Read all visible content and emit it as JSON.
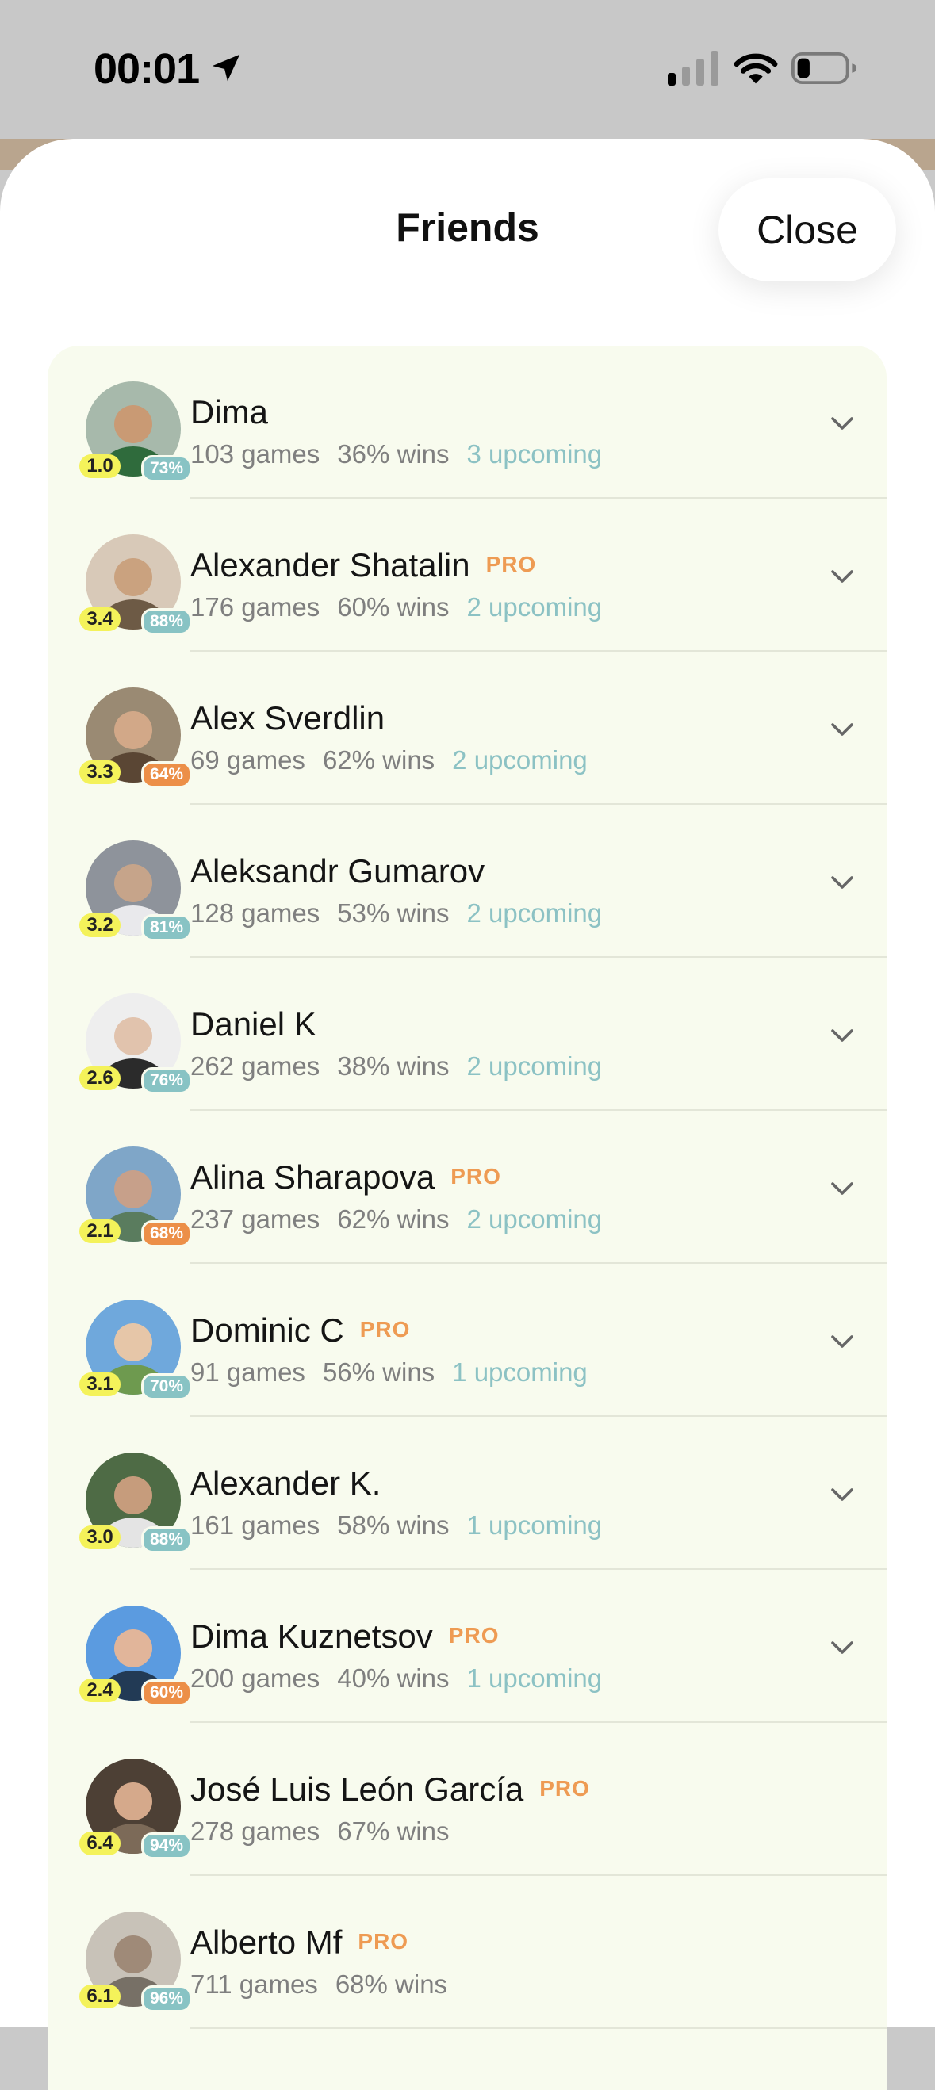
{
  "status_bar": {
    "time": "00:01",
    "icons": [
      "location-arrow-icon",
      "cellular-signal-icon",
      "wifi-icon",
      "battery-icon"
    ]
  },
  "sheet": {
    "title": "Friends",
    "close_label": "Close"
  },
  "colors": {
    "card_bg": "#f8fbee",
    "rating_badge": "#f4f25a",
    "pct_teal": "#88c3c4",
    "pct_orange": "#ec8f48",
    "pro": "#ee9b53",
    "upcoming": "#8cc2c4"
  },
  "friends": [
    {
      "name": "Dima",
      "pro": "",
      "rating": "1.0",
      "pct": "73%",
      "pct_color": "teal",
      "games": "103 games",
      "wins": "36% wins",
      "upcoming": "3 upcoming",
      "expandable": true
    },
    {
      "name": "Alexander Shatalin",
      "pro": "PRO",
      "rating": "3.4",
      "pct": "88%",
      "pct_color": "teal",
      "games": "176 games",
      "wins": "60% wins",
      "upcoming": "2 upcoming",
      "expandable": true
    },
    {
      "name": "Alex Sverdlin",
      "pro": "",
      "rating": "3.3",
      "pct": "64%",
      "pct_color": "orange",
      "games": "69 games",
      "wins": "62% wins",
      "upcoming": "2 upcoming",
      "expandable": true
    },
    {
      "name": "Aleksandr Gumarov",
      "pro": "",
      "rating": "3.2",
      "pct": "81%",
      "pct_color": "teal",
      "games": "128 games",
      "wins": "53% wins",
      "upcoming": "2 upcoming",
      "expandable": true
    },
    {
      "name": "Daniel K",
      "pro": "",
      "rating": "2.6",
      "pct": "76%",
      "pct_color": "teal",
      "games": "262 games",
      "wins": "38% wins",
      "upcoming": "2 upcoming",
      "expandable": true
    },
    {
      "name": "Alina Sharapova",
      "pro": "PRO",
      "rating": "2.1",
      "pct": "68%",
      "pct_color": "orange",
      "games": "237 games",
      "wins": "62% wins",
      "upcoming": "2 upcoming",
      "expandable": true
    },
    {
      "name": "Dominic C",
      "pro": "PRO",
      "rating": "3.1",
      "pct": "70%",
      "pct_color": "teal",
      "games": "91 games",
      "wins": "56% wins",
      "upcoming": "1 upcoming",
      "expandable": true
    },
    {
      "name": "Alexander K.",
      "pro": "",
      "rating": "3.0",
      "pct": "88%",
      "pct_color": "teal",
      "games": "161 games",
      "wins": "58% wins",
      "upcoming": "1 upcoming",
      "expandable": true
    },
    {
      "name": "Dima Kuznetsov",
      "pro": "PRO",
      "rating": "2.4",
      "pct": "60%",
      "pct_color": "orange",
      "games": "200 games",
      "wins": "40% wins",
      "upcoming": "1 upcoming",
      "expandable": true
    },
    {
      "name": "José Luis León García",
      "pro": "PRO",
      "rating": "6.4",
      "pct": "94%",
      "pct_color": "teal",
      "games": "278 games",
      "wins": "67% wins",
      "upcoming": "",
      "expandable": false
    },
    {
      "name": "Alberto Mf",
      "pro": "PRO",
      "rating": "6.1",
      "pct": "96%",
      "pct_color": "teal",
      "games": "711 games",
      "wins": "68% wins",
      "upcoming": "",
      "expandable": false
    }
  ]
}
